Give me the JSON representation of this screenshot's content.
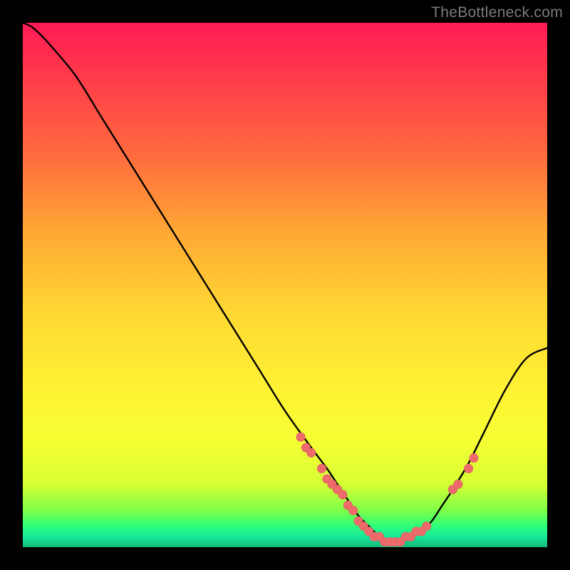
{
  "watermark": "TheBottleneck.com",
  "colors": {
    "curve": "#000000",
    "dot": "#ef6b6b",
    "background_black": "#000000"
  },
  "chart_data": {
    "type": "line",
    "title": "",
    "xlabel": "",
    "ylabel": "",
    "xlim": [
      0,
      100
    ],
    "ylim": [
      0,
      100
    ],
    "grid": false,
    "legend": false,
    "note": "Values estimated from pixel positions on a gradient background; y=0 at bottom (green), y=100 at top (red). Curve represents a bottleneck-style V shape with minimum near x≈70.",
    "series": [
      {
        "name": "curve",
        "x": [
          0,
          2,
          5,
          10,
          15,
          20,
          25,
          30,
          35,
          40,
          45,
          50,
          55,
          58,
          60,
          62,
          64,
          66,
          68,
          70,
          72,
          74,
          76,
          78,
          80,
          82,
          85,
          88,
          92,
          96,
          100
        ],
        "y": [
          100,
          99,
          96,
          90,
          82,
          74,
          66,
          58,
          50,
          42,
          34,
          26,
          19,
          15,
          12,
          9,
          6,
          4,
          2,
          1,
          1,
          2,
          3,
          5,
          8,
          11,
          16,
          22,
          30,
          36,
          38
        ]
      }
    ],
    "markers": {
      "name": "highlighted-points",
      "description": "Salmon dots overlaid along the curve near the trough and right slope",
      "points": [
        {
          "x": 53,
          "y": 21
        },
        {
          "x": 54,
          "y": 19
        },
        {
          "x": 55,
          "y": 18
        },
        {
          "x": 57,
          "y": 15
        },
        {
          "x": 58,
          "y": 13
        },
        {
          "x": 59,
          "y": 12
        },
        {
          "x": 60,
          "y": 11
        },
        {
          "x": 61,
          "y": 10
        },
        {
          "x": 62,
          "y": 8
        },
        {
          "x": 63,
          "y": 7
        },
        {
          "x": 64,
          "y": 5
        },
        {
          "x": 65,
          "y": 4
        },
        {
          "x": 66,
          "y": 3
        },
        {
          "x": 67,
          "y": 2
        },
        {
          "x": 68,
          "y": 2
        },
        {
          "x": 69,
          "y": 1
        },
        {
          "x": 70,
          "y": 1
        },
        {
          "x": 71,
          "y": 1
        },
        {
          "x": 72,
          "y": 1
        },
        {
          "x": 73,
          "y": 2
        },
        {
          "x": 74,
          "y": 2
        },
        {
          "x": 75,
          "y": 3
        },
        {
          "x": 76,
          "y": 3
        },
        {
          "x": 77,
          "y": 4
        },
        {
          "x": 82,
          "y": 11
        },
        {
          "x": 83,
          "y": 12
        },
        {
          "x": 85,
          "y": 15
        },
        {
          "x": 86,
          "y": 17
        }
      ]
    }
  }
}
